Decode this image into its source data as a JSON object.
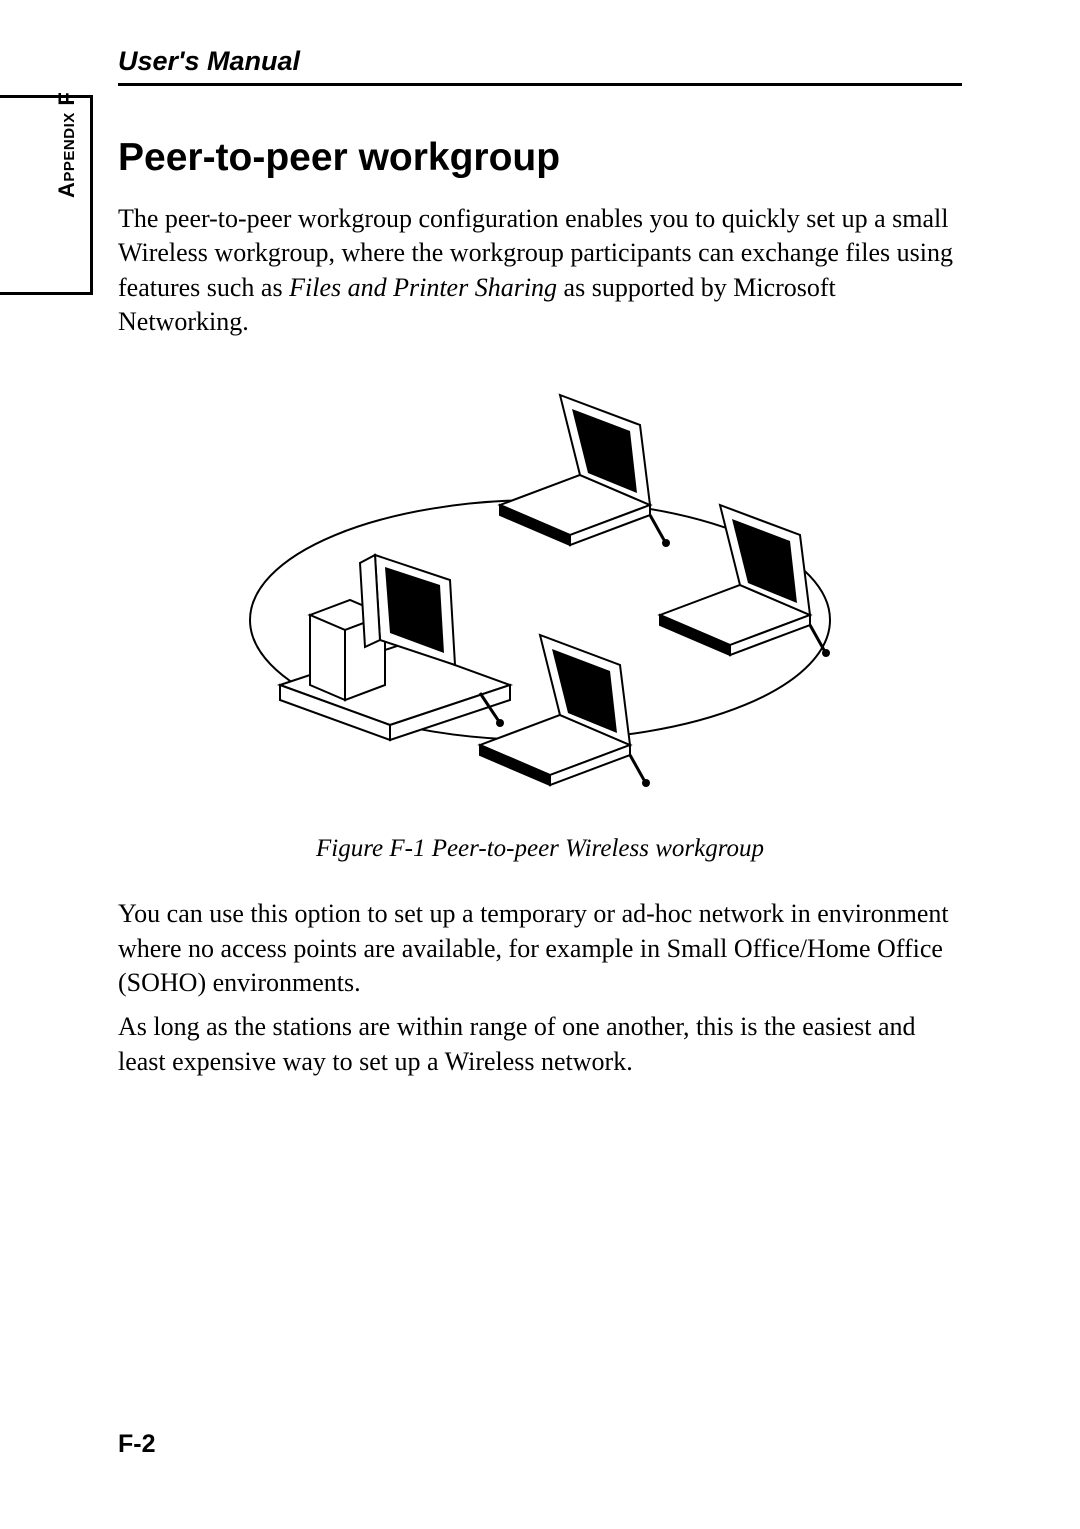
{
  "header": {
    "title": "User's Manual"
  },
  "sidebar": {
    "label_prefix": "Appendix",
    "label_letter": "F"
  },
  "section": {
    "heading": "Peer-to-peer workgroup",
    "intro_pre": "The peer-to-peer workgroup configuration enables you to quickly set up a small Wireless workgroup, where the workgroup participants can exchange files using features such as ",
    "intro_em": "Files and Printer Sharing",
    "intro_post": " as supported by Microsoft Networking."
  },
  "figure": {
    "caption": "Figure F-1  Peer-to-peer Wireless workgroup"
  },
  "para2": "You can use this option to set up a temporary or ad-hoc network in environment where no access points are available, for example in Small Office/Home Office (SOHO) environments.",
  "para3": "As long as the stations are within range of one another, this is the easiest and least expensive way to set up a Wireless network.",
  "footer": {
    "page_number": "F-2"
  }
}
